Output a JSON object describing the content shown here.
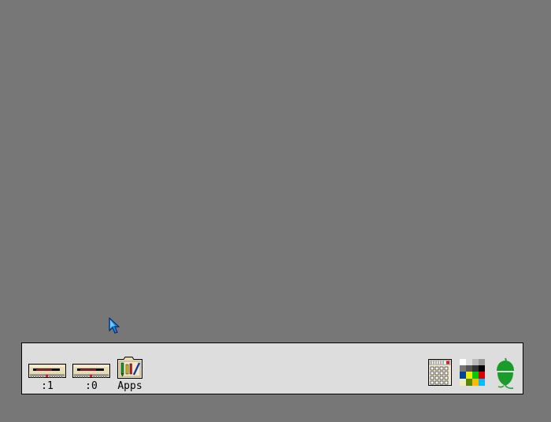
{
  "desktop": {
    "background_color": "#777777"
  },
  "iconbar": {
    "background_color": "#dddddd",
    "left_items": [
      {
        "name": "floppy-drive-1",
        "icon": "floppy-drive-icon",
        "label": ":1"
      },
      {
        "name": "floppy-drive-0",
        "icon": "floppy-drive-icon",
        "label": ":0"
      },
      {
        "name": "apps-directory",
        "icon": "apps-folder-icon",
        "label": "Apps"
      }
    ],
    "right_items": [
      {
        "name": "task-manager",
        "icon": "task-manager-icon"
      },
      {
        "name": "palette-utility",
        "icon": "palette-icon"
      },
      {
        "name": "acorn-menu",
        "icon": "acorn-icon"
      }
    ]
  },
  "pointer": {
    "icon": "mouse-pointer-icon",
    "color": "#1a6fd0"
  }
}
